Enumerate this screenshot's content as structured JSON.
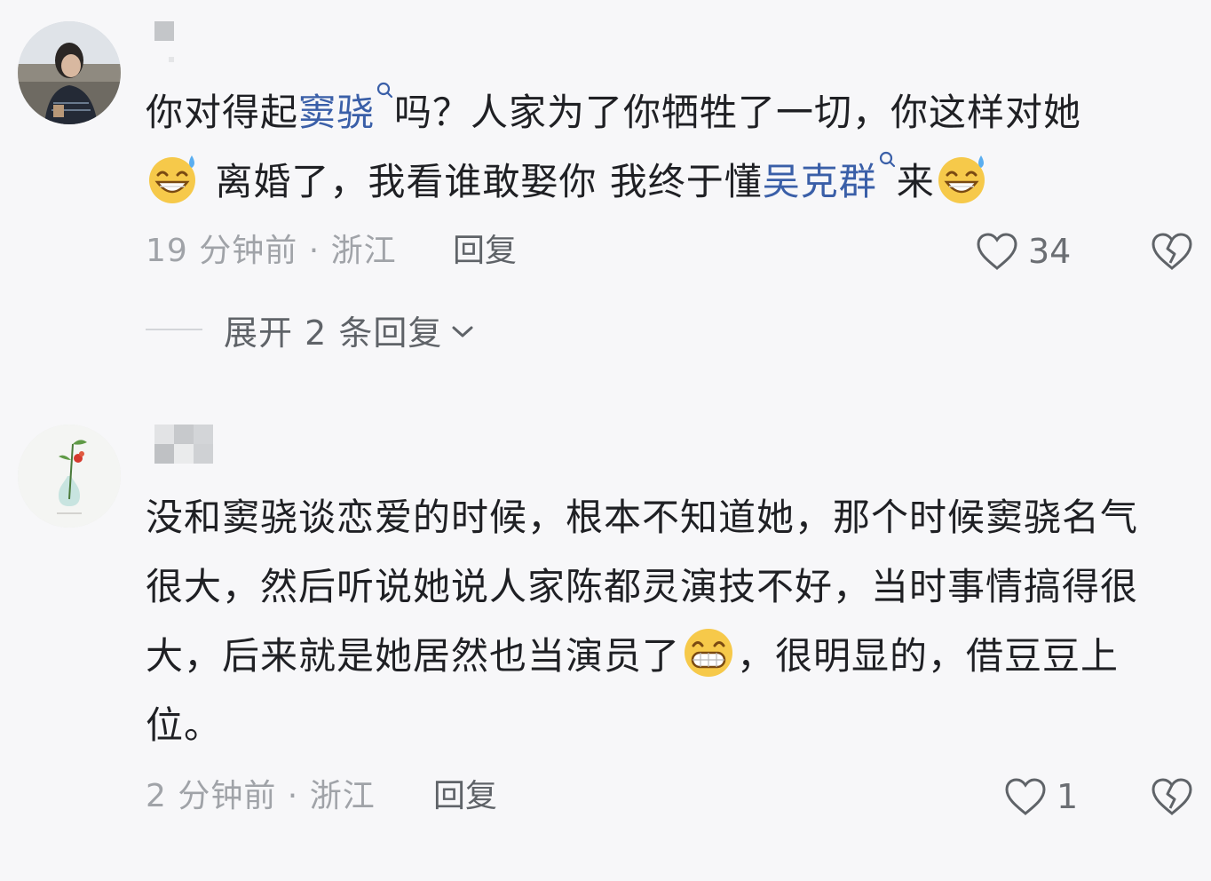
{
  "comments": [
    {
      "avatar_icon": "user-photo-avatar",
      "username": "",
      "text": {
        "p1": "你对得起",
        "mention1": "窦骁",
        "p2": "吗？人家为了你牺牲了一切，你这样对她",
        "emoji1": "sweat-smile-emoji",
        "p3": " 离婚了，我看谁敢娶你 我终于懂",
        "mention2": "吴克群",
        "p4": "来",
        "emoji2": "sweat-smile-emoji"
      },
      "time": "19 分钟前",
      "location": "浙江",
      "separator": " · ",
      "reply_label": "回复",
      "likes": "34",
      "expand_label": "展开 2 条回复"
    },
    {
      "avatar_icon": "flower-vase-avatar",
      "username": "",
      "text": {
        "p1": "没和窦骁谈恋爱的时候，根本不知道她，那个时候窦骁名气很大，然后听说她说人家陈都灵演技不好，当时事情搞得很大，后来就是她居然也当演员了",
        "emoji1": "grin-emoji",
        "p2": "，很明显的，借豆豆上位。"
      },
      "time": "2 分钟前",
      "location": "浙江",
      "separator": " · ",
      "reply_label": "回复",
      "likes": "1"
    }
  ],
  "colors": {
    "background": "#f7f7f9",
    "text": "#1f2024",
    "link": "#3a5fa8",
    "meta": "#a0a3a8",
    "emoji_face": "#f6c94a",
    "emoji_sweat": "#5aaef0"
  }
}
